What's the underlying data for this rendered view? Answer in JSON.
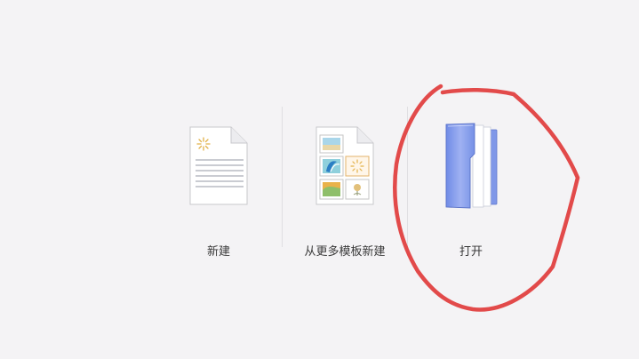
{
  "actions": [
    {
      "id": "new",
      "label": "新建",
      "icon": "blank-document-icon"
    },
    {
      "id": "new-from-template",
      "label": "从更多模板新建",
      "icon": "template-document-icon"
    },
    {
      "id": "open",
      "label": "打开",
      "icon": "folder-icon"
    }
  ],
  "colors": {
    "background": "#f4f3f5",
    "folder": "#7f97e8",
    "annotation": "#e24a4a"
  }
}
